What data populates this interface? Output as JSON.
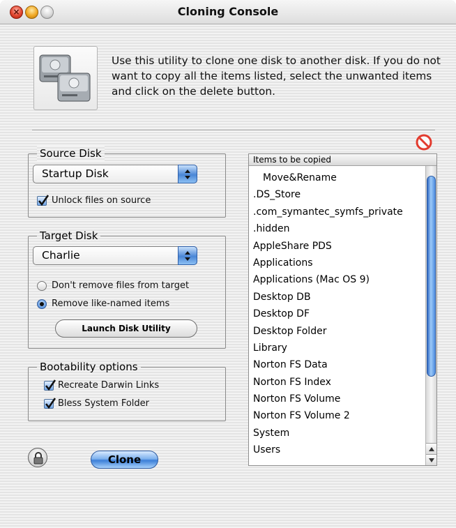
{
  "window": {
    "title": "Cloning Console"
  },
  "intro": {
    "text": "Use this utility to clone one disk to another disk.  If you do not want to copy all the items listed, select the unwanted items and click on the delete button."
  },
  "source": {
    "legend": "Source Disk",
    "selected": "Startup Disk",
    "unlock_label": "Unlock files on source",
    "unlock_checked": true
  },
  "target": {
    "legend": "Target Disk",
    "selected": "Charlie",
    "radio_dont_remove": "Don't remove files from target",
    "radio_remove": "Remove like-named items",
    "selected_option": "Remove like-named items",
    "launch_button": "Launch Disk Utility"
  },
  "boot": {
    "legend": "Bootability options",
    "recreate_label": "Recreate Darwin Links",
    "recreate_checked": true,
    "bless_label": "Bless System Folder",
    "bless_checked": true
  },
  "list": {
    "header": "Items to be copied",
    "items": [
      "Move&Rename",
      ".DS_Store",
      ".com_symantec_symfs_private",
      ".hidden",
      "AppleShare PDS",
      "Applications",
      "Applications (Mac OS 9)",
      "Desktop DB",
      "Desktop DF",
      "Desktop Folder",
      "Library",
      "Norton FS Data",
      "Norton FS Index",
      "Norton FS Volume",
      "Norton FS Volume 2",
      "System",
      "Users"
    ]
  },
  "actions": {
    "clone": "Clone"
  },
  "icons": {
    "close": "close-icon",
    "minimize": "minimize-icon",
    "zoom": "zoom-icon",
    "app": "hard-drives-icon",
    "delete": "delete-icon",
    "lock": "lock-icon",
    "popup": "chevron-updown-icon"
  },
  "colors": {
    "accent_blue": "#3c7fd8",
    "delete_red": "#e23b2e"
  }
}
